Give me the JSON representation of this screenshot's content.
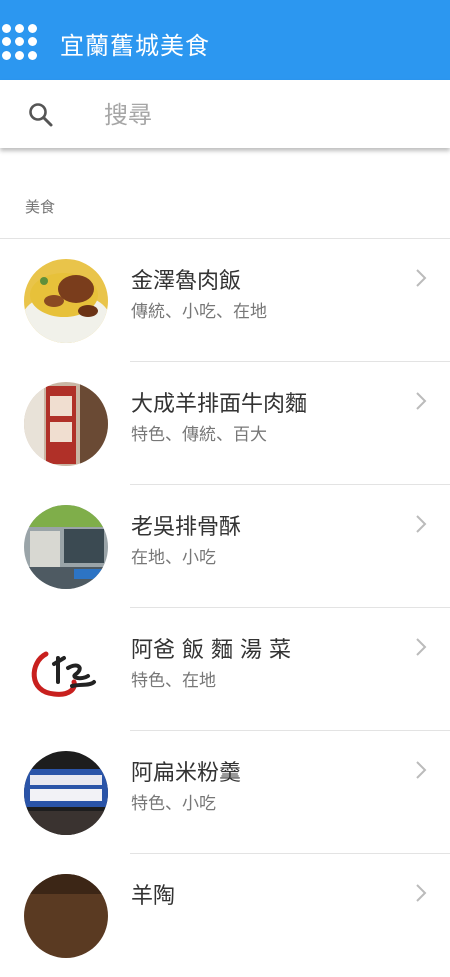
{
  "appbar": {
    "title": "宜蘭舊城美食",
    "menu_icon": "apps-grid-icon"
  },
  "search": {
    "placeholder": "搜尋",
    "icon": "search-icon"
  },
  "section": {
    "title": "美食"
  },
  "items": [
    {
      "name": "金澤魯肉飯",
      "tags": "傳統、小吃、在地",
      "icon": "chevron-right-icon"
    },
    {
      "name": "大成羊排面牛肉麵",
      "tags": "特色、傳統、百大",
      "icon": "chevron-right-icon"
    },
    {
      "name": "老吳排骨酥",
      "tags": "在地、小吃",
      "icon": "chevron-right-icon"
    },
    {
      "name": "阿爸 飯 麵 湯 菜",
      "tags": "特色、在地",
      "icon": "chevron-right-icon"
    },
    {
      "name": "阿扁米粉羹",
      "tags": "特色、小吃",
      "icon": "chevron-right-icon"
    },
    {
      "name": "羊陶",
      "tags": "",
      "icon": "chevron-right-icon"
    }
  ],
  "colors": {
    "appbar": "#2c97f0",
    "text_primary": "#333333",
    "text_secondary": "#777777",
    "divider": "#e3e3e3"
  }
}
